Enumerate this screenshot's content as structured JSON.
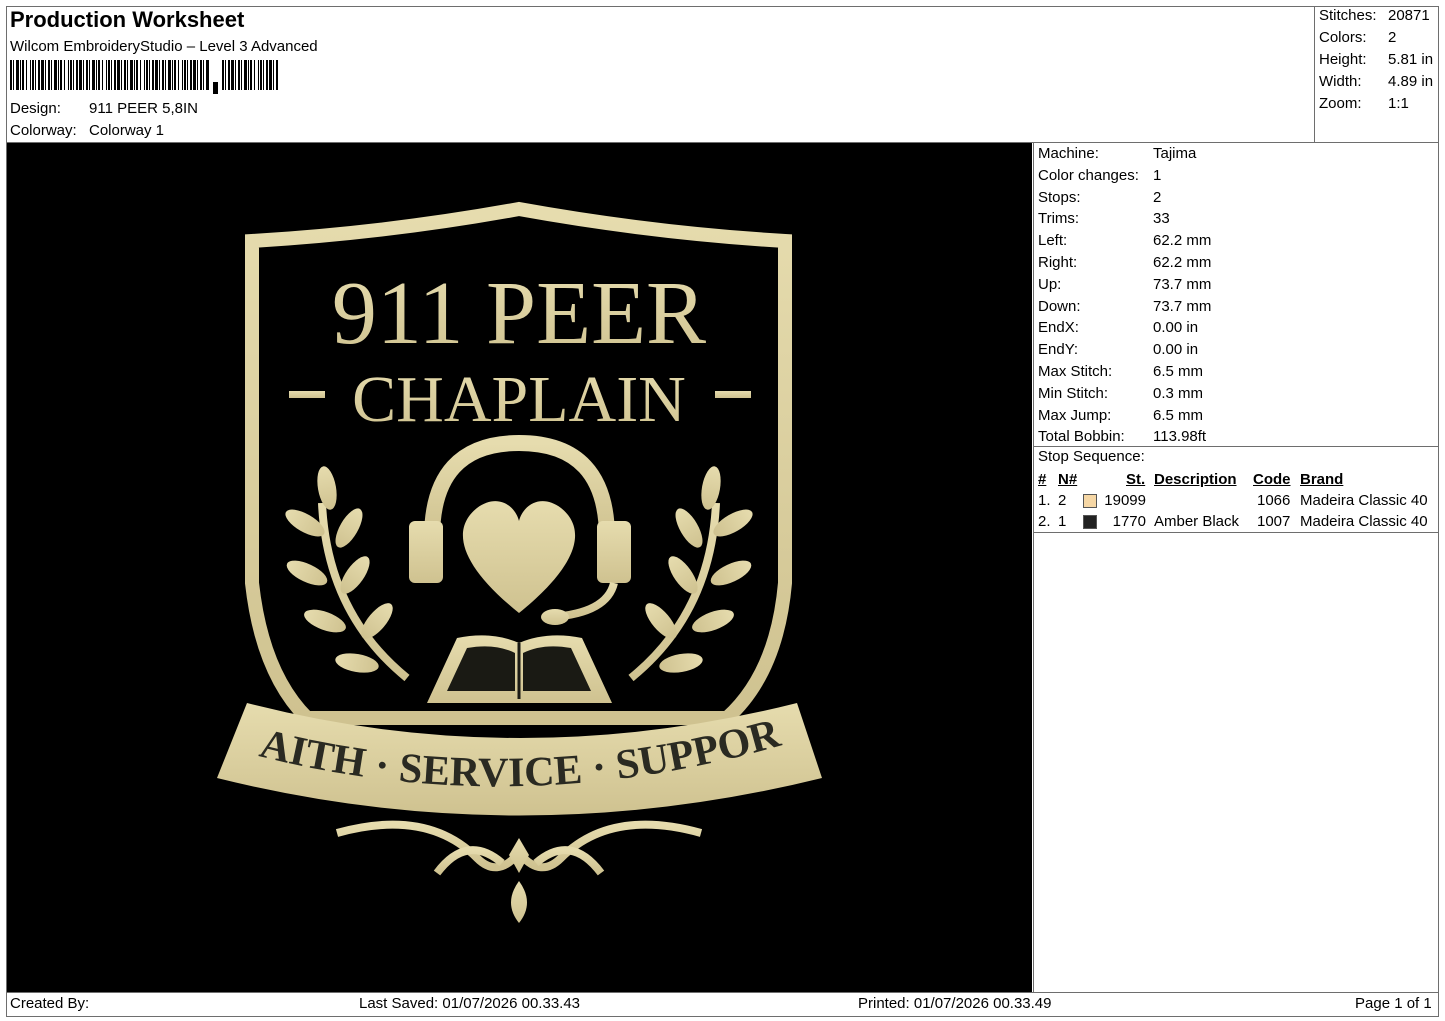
{
  "header": {
    "title": "Production Worksheet",
    "software": "Wilcom EmbroideryStudio – Level 3 Advanced",
    "design_label": "Design:",
    "design_value": "911 PEER 5,8IN",
    "colorway_label": "Colorway:",
    "colorway_value": "Colorway 1"
  },
  "summary": {
    "stitches_label": "Stitches:",
    "stitches_value": "20871",
    "colors_label": "Colors:",
    "colors_value": "2",
    "height_label": "Height:",
    "height_value": "5.81 in",
    "width_label": "Width:",
    "width_value": "4.89 in",
    "zoom_label": "Zoom:",
    "zoom_value": "1:1"
  },
  "machine_info": [
    {
      "label": "Machine:",
      "value": "Tajima"
    },
    {
      "label": "Color changes:",
      "value": "1"
    },
    {
      "label": "Stops:",
      "value": "2"
    },
    {
      "label": "Trims:",
      "value": "33"
    },
    {
      "label": "Left:",
      "value": "62.2 mm"
    },
    {
      "label": "Right:",
      "value": "62.2 mm"
    },
    {
      "label": "Up:",
      "value": "73.7 mm"
    },
    {
      "label": "Down:",
      "value": "73.7 mm"
    },
    {
      "label": "EndX:",
      "value": "0.00 in"
    },
    {
      "label": "EndY:",
      "value": "0.00 in"
    },
    {
      "label": "Max Stitch:",
      "value": "6.5 mm"
    },
    {
      "label": "Min Stitch:",
      "value": "0.3 mm"
    },
    {
      "label": "Max Jump:",
      "value": "6.5 mm"
    },
    {
      "label": "Total Bobbin:",
      "value": "113.98ft"
    }
  ],
  "stop_sequence": {
    "title": "Stop Sequence:",
    "headers": {
      "num": "#",
      "n": "N#",
      "st": "St.",
      "description": "Description",
      "code": "Code",
      "brand": "Brand"
    },
    "rows": [
      {
        "num": "1.",
        "n": "2",
        "color": "#f6d7a5",
        "st": "19099",
        "description": "",
        "code": "1066",
        "brand": "Madeira Classic 40"
      },
      {
        "num": "2.",
        "n": "1",
        "color": "#222222",
        "st": "1770",
        "description": "Amber Black",
        "code": "1007",
        "brand": "Madeira Classic 40"
      }
    ]
  },
  "design_art": {
    "line1": "911 PEER",
    "line2": "CHAPLAIN",
    "line2_dash_left": "-",
    "line2_dash_right": "-",
    "banner_text": "FAITH · SERVICE · SUPPORT",
    "thread_color": "#d8cc9a",
    "background_color": "#000000",
    "text_dark": "#2a2a22"
  },
  "footer": {
    "created_by": "Created By:",
    "last_saved": "Last Saved: 01/07/2026 00.33.43",
    "printed": "Printed: 01/07/2026 00.33.49",
    "page": "Page 1 of 1"
  }
}
